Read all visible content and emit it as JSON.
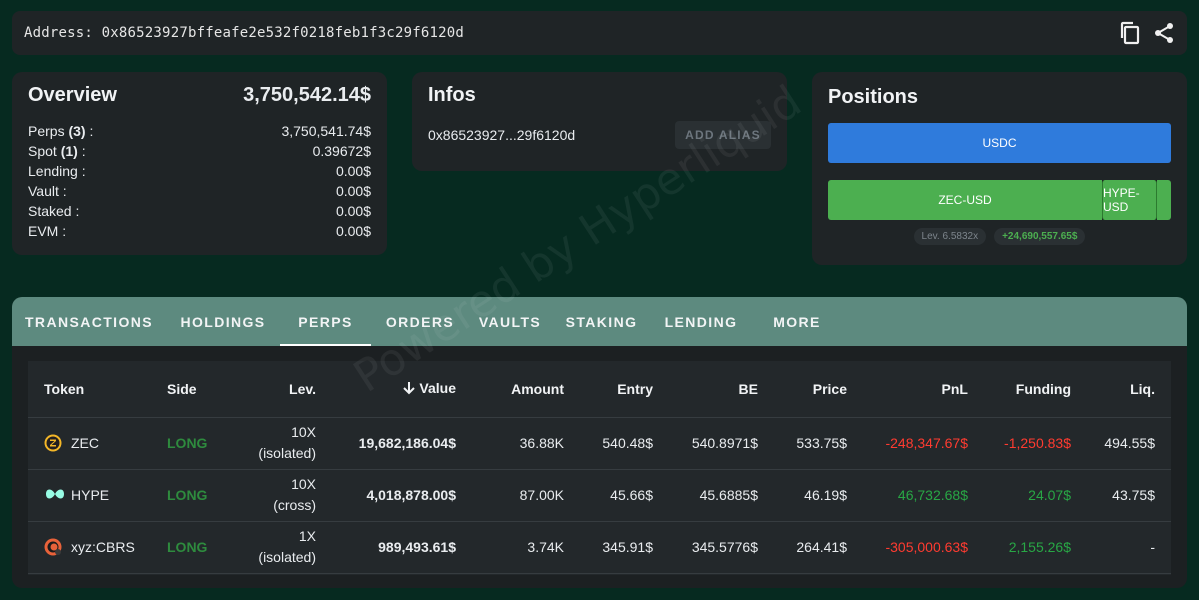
{
  "address_bar": {
    "label": "Address: 0x86523927bffeafe2e532f0218feb1f3c29f6120d",
    "icons": [
      "copy-icon",
      "share-icon"
    ]
  },
  "overview": {
    "title": "Overview",
    "total": "3,750,542.14$",
    "rows": [
      {
        "label": "Perps",
        "count": "(3)",
        "suffix": " :",
        "value": "3,750,541.74$"
      },
      {
        "label": "Spot",
        "count": "(1)",
        "suffix": " :",
        "value": "0.39672$"
      },
      {
        "label": "Lending :",
        "count": "",
        "suffix": "",
        "value": "0.00$"
      },
      {
        "label": "Vault :",
        "count": "",
        "suffix": "",
        "value": "0.00$"
      },
      {
        "label": "Staked :",
        "count": "",
        "suffix": "",
        "value": "0.00$"
      },
      {
        "label": "EVM :",
        "count": "",
        "suffix": "",
        "value": "0.00$"
      }
    ]
  },
  "infos": {
    "title": "Infos",
    "address_short": "0x86523927...29f6120d",
    "alias_button": "ADD ALIAS"
  },
  "positions": {
    "title": "Positions",
    "spot_bar": "USDC",
    "perp_bars": [
      "ZEC-USD",
      "HYPE-USD",
      ""
    ],
    "leverage": "Lev. 6.5832x",
    "pnl": "+24,690,557.65$",
    "colors": {
      "spot": "#2f7bdc",
      "perp": "#4caf50"
    }
  },
  "tabs": [
    "TRANSACTIONS",
    "HOLDINGS",
    "PERPS",
    "ORDERS",
    "VAULTS",
    "STAKING",
    "LENDING",
    "MORE"
  ],
  "active_tab": "PERPS",
  "table": {
    "headers": [
      "Token",
      "Side",
      "Lev.",
      "Value",
      "Amount",
      "Entry",
      "BE",
      "Price",
      "PnL",
      "Funding",
      "Liq."
    ],
    "sort_icon": "arrow-down-icon",
    "rows": [
      {
        "token": "ZEC",
        "icon": "zec-icon",
        "side": "LONG",
        "lev": "10X",
        "mode": "(isolated)",
        "value": "19,682,186.04$",
        "amount": "36.88K",
        "entry": "540.48$",
        "be": "540.8971$",
        "price": "533.75$",
        "pnl": "-248,347.67$",
        "funding": "-1,250.83$",
        "liq": "494.55$"
      },
      {
        "token": "HYPE",
        "icon": "hype-icon",
        "side": "LONG",
        "lev": "10X",
        "mode": "(cross)",
        "value": "4,018,878.00$",
        "amount": "87.00K",
        "entry": "45.66$",
        "be": "45.6885$",
        "price": "46.19$",
        "pnl": "46,732.68$",
        "funding": "24.07$",
        "liq": "43.75$"
      },
      {
        "token": "xyz:CBRS",
        "icon": "cbrs-icon",
        "side": "LONG",
        "lev": "1X",
        "mode": "(isolated)",
        "value": "989,493.61$",
        "amount": "3.74K",
        "entry": "345.91$",
        "be": "345.5776$",
        "price": "264.41$",
        "pnl": "-305,000.63$",
        "funding": "2,155.26$",
        "liq": "-"
      }
    ]
  },
  "watermark": "Powered by Hyperliquid"
}
